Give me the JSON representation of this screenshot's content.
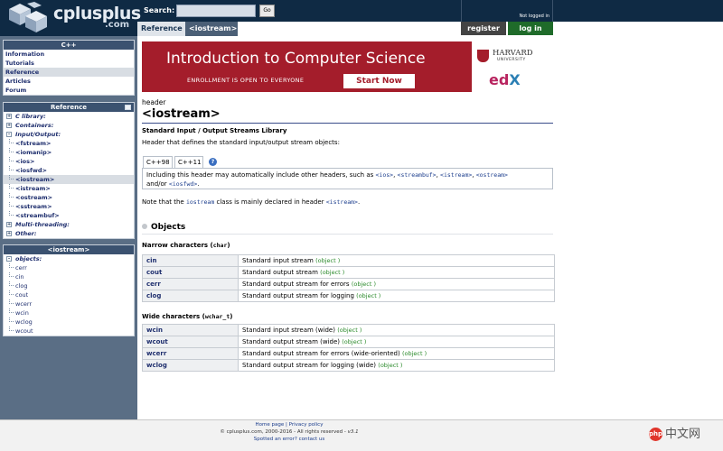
{
  "header": {
    "logo_text": "cplusplus",
    "logo_suffix": ".com",
    "search_label": "Search:",
    "search_value": "",
    "go_label": "Go",
    "login_status": "Not logged in",
    "register_label": "register",
    "login_label": "log in",
    "breadcrumb": [
      "Reference",
      "<iostream>"
    ]
  },
  "sidebar": {
    "cpp_box": {
      "title": "C++",
      "items": [
        "Information",
        "Tutorials",
        "Reference",
        "Articles",
        "Forum"
      ],
      "selected": "Reference"
    },
    "reference_box": {
      "title": "Reference",
      "categories_top": [
        {
          "label": "C library:",
          "expander": "+"
        },
        {
          "label": "Containers:",
          "expander": "+"
        },
        {
          "label": "Input/Output:",
          "expander": "-"
        }
      ],
      "io_headers": [
        "<fstream>",
        "<iomanip>",
        "<ios>",
        "<iosfwd>",
        "<iostream>",
        "<istream>",
        "<ostream>",
        "<sstream>",
        "<streambuf>"
      ],
      "selected": "<iostream>",
      "categories_bottom": [
        {
          "label": "Multi-threading:",
          "expander": "+"
        },
        {
          "label": "Other:",
          "expander": "+"
        }
      ]
    },
    "header_box": {
      "title": "<iostream>",
      "category": "objects:",
      "expander": "-",
      "items": [
        "cerr",
        "cin",
        "clog",
        "cout",
        "wcerr",
        "wcin",
        "wclog",
        "wcout"
      ]
    }
  },
  "banner": {
    "title": "Introduction to Computer Science",
    "subtitle": "ENROLLMENT IS OPEN TO EVERYONE",
    "button": "Start Now",
    "harvard": "HARVARD",
    "university": "UNIVERSITY",
    "edx_e": "ed",
    "edx_x": "X"
  },
  "main": {
    "pre_title": "header",
    "title": "<iostream>",
    "subtitle": "Standard Input / Output Streams Library",
    "description": "Header that defines the standard input/output stream objects:",
    "tabs": [
      "C++98",
      "C++11"
    ],
    "help_icon": "?",
    "tab_panel": {
      "prefix": "Including this header may automatically include other headers, such as ",
      "headers": [
        "<ios>",
        "<streambuf>",
        "<istream>",
        "<ostream>",
        "<iosfwd>"
      ],
      "sep1": ", ",
      "and_or": " and/or ",
      "suffix": "."
    },
    "note": {
      "prefix": "Note that the ",
      "code": "iostream",
      "middle": " class is mainly declared in header ",
      "header": "<istream>",
      "suffix": "."
    },
    "section_title": "Objects",
    "narrow": {
      "heading": "Narrow characters (",
      "type": "char",
      "close": ")",
      "rows": [
        {
          "name": "cin",
          "desc": "Standard input stream",
          "kind": "(object )"
        },
        {
          "name": "cout",
          "desc": "Standard output stream",
          "kind": "(object )"
        },
        {
          "name": "cerr",
          "desc": "Standard output stream for errors",
          "kind": "(object )"
        },
        {
          "name": "clog",
          "desc": "Standard output stream for logging",
          "kind": "(object )"
        }
      ]
    },
    "wide": {
      "heading": "Wide characters (",
      "type": "wchar_t",
      "close": ")",
      "rows": [
        {
          "name": "wcin",
          "desc": "Standard input stream (wide)",
          "kind": "(object )"
        },
        {
          "name": "wcout",
          "desc": "Standard output stream (wide)",
          "kind": "(object )"
        },
        {
          "name": "wcerr",
          "desc": "Standard output stream for errors (wide-oriented)",
          "kind": "(object )"
        },
        {
          "name": "wclog",
          "desc": "Standard output stream for logging (wide)",
          "kind": "(object )"
        }
      ]
    }
  },
  "footer": {
    "home_link": "Home page",
    "separator": " | ",
    "privacy_link": "Privacy policy",
    "copyright": "© cplusplus.com, 2000-2016 - All rights reserved - ",
    "version": "v3.1",
    "spotted": "Spotted an error? contact us"
  },
  "watermark": {
    "logo": "php",
    "text": "中文网"
  },
  "colors": {
    "header_bg": "#0f2a44",
    "sidebar_bg": "#5a6e85",
    "box_title_bg": "#3b5270",
    "banner_red": "#a41d2b",
    "login_green": "#1f6b2a",
    "link_blue": "#1a3c8c",
    "object_green": "#2a8a2a"
  }
}
